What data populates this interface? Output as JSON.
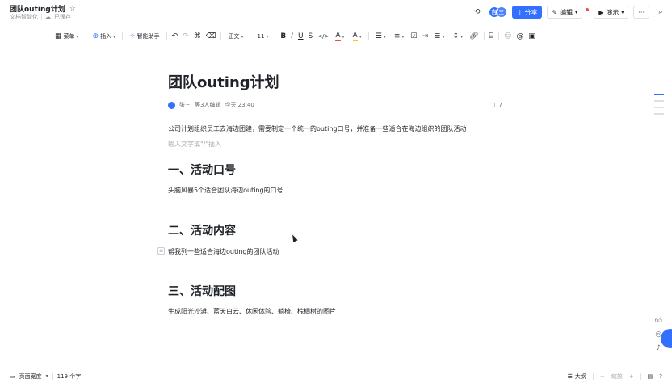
{
  "header": {
    "title": "团队outing计划",
    "star_icon": "star-icon",
    "sub_label": "文档智能化",
    "saved_label": "已保存",
    "avatar_1": "吉",
    "avatar_2": "三",
    "share_label": "分享",
    "edit_label": "编辑",
    "present_label": "演示",
    "more_label": "···"
  },
  "toolbar": {
    "menu_label": "菜单",
    "insert_label": "插入",
    "assistant_label": "智能助手",
    "text_style": "正文",
    "font_size": "11",
    "bold": "B",
    "italic": "I",
    "underline": "U",
    "strike": "S",
    "code": "</>",
    "font_color": "A",
    "highlight": "A"
  },
  "doc": {
    "title": "团队outing计划",
    "meta_author": "张三",
    "meta_editors": "等3人编辑",
    "meta_time": "今天 23:40",
    "meta_comments": "7",
    "intro": "公司计划组织员工去海边团建，需要制定一个统一的outing口号，并准备一些适合在海边组织的团队活动",
    "placeholder": "输入文字或\"/\"插入",
    "sections": [
      {
        "heading": "一、活动口号",
        "body": "头脑风暴5个适合团队海边outing的口号"
      },
      {
        "heading": "二、活动内容",
        "body": "帮我列一些适合海边outing的团队活动"
      },
      {
        "heading": "三、活动配图",
        "body": "生成阳光沙滩、蓝天白云、休闲体验、躺椅、棕榈树的图片"
      }
    ]
  },
  "footer": {
    "page_width_label": "页面宽度",
    "word_count": "119 个字",
    "outline_label": "大纲",
    "zoom_label": "缩放"
  },
  "colors": {
    "accent": "#3370ff",
    "text": "#1f2329",
    "muted": "#8f959e"
  }
}
